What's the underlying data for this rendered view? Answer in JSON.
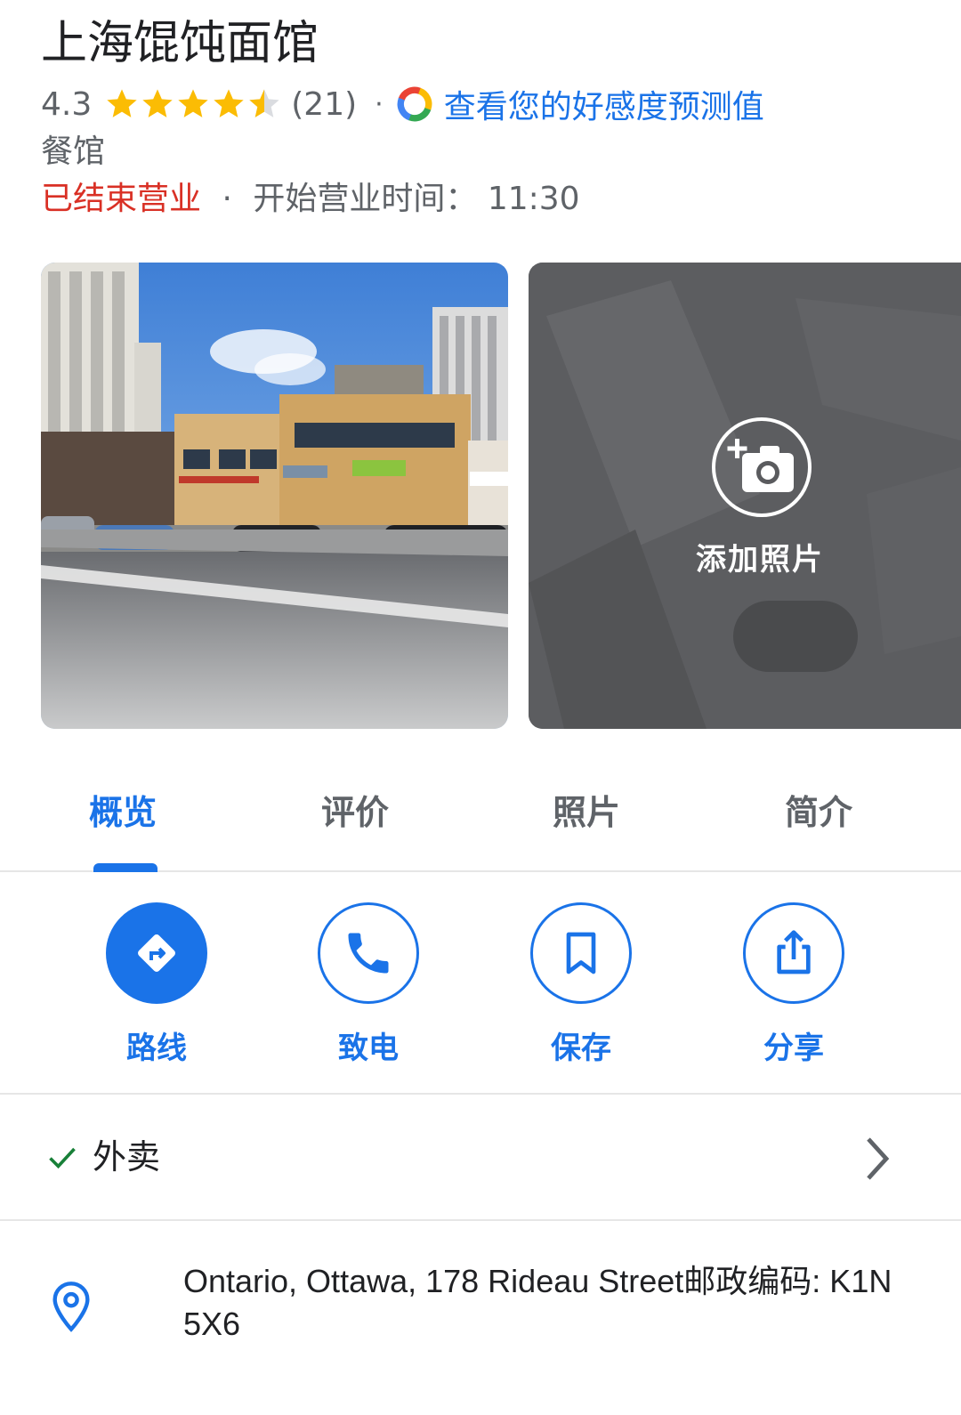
{
  "place": {
    "name": "上海馄饨面馆",
    "rating": "4.3",
    "rating_stars": 4.3,
    "review_count": "(21)",
    "separator": "·",
    "prediction_link": "查看您的好感度预测值",
    "category": "餐馆",
    "status": "已结束营业",
    "hours_separator": "·",
    "hours_text": "开始营业时间： 11:30"
  },
  "photos": {
    "add_label": "添加照片"
  },
  "tabs": [
    {
      "label": "概览",
      "active": true
    },
    {
      "label": "评价",
      "active": false
    },
    {
      "label": "照片",
      "active": false
    },
    {
      "label": "简介",
      "active": false
    }
  ],
  "actions": [
    {
      "label": "路线",
      "icon": "directions-icon"
    },
    {
      "label": "致电",
      "icon": "phone-icon"
    },
    {
      "label": "保存",
      "icon": "bookmark-icon"
    },
    {
      "label": "分享",
      "icon": "share-icon"
    }
  ],
  "takeout": {
    "label": "外卖",
    "icon": "check-icon"
  },
  "address": {
    "text": "Ontario, Ottawa, 178 Rideau Street邮政编码: K1N 5X6",
    "icon": "location-pin-icon"
  },
  "colors": {
    "accent": "#1a73e8",
    "closed": "#d93025",
    "star": "#fbbc04",
    "check": "#188038"
  }
}
